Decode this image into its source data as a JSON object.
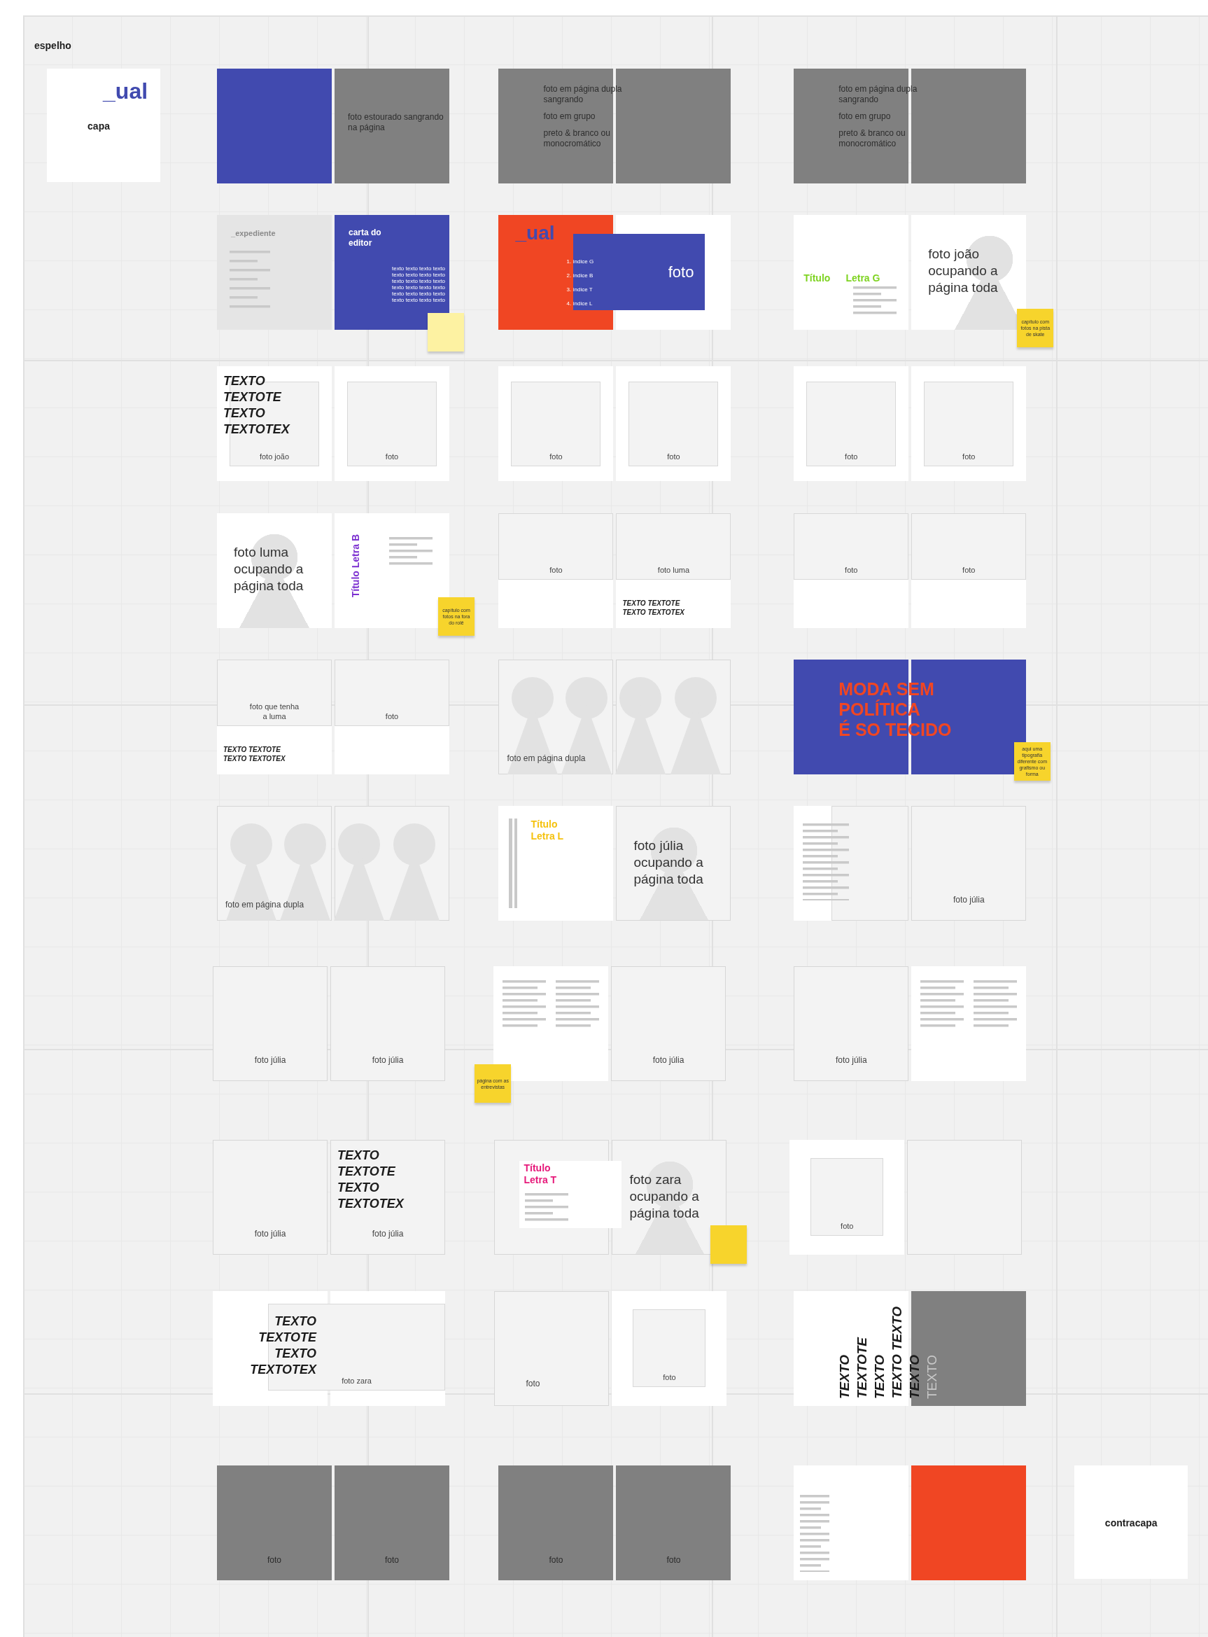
{
  "board_label": "espelho",
  "cards": [
    {
      "logo": "_ual",
      "label": "capa"
    },
    {
      "label": "contracapa"
    }
  ],
  "spreads": [
    {
      "pages": [
        {
          "kind": "blue"
        },
        {
          "kind": "gray",
          "elements": [
            {
              "kind": "note",
              "paragraphs": [
                "foto estourado sangrando na página"
              ]
            }
          ]
        }
      ]
    },
    {
      "pages": [
        {
          "kind": "gray"
        },
        {
          "kind": "gray"
        }
      ],
      "overlays": [
        {
          "kind": "note",
          "paragraphs": [
            "foto em página dupla sangrando",
            "foto em grupo",
            "preto & branco ou monocromático"
          ]
        }
      ]
    },
    {
      "pages": [
        {
          "kind": "gray"
        },
        {
          "kind": "gray"
        }
      ],
      "overlays": [
        {
          "kind": "note",
          "paragraphs": [
            "foto em página dupla sangrando",
            "foto em grupo",
            "preto & branco ou monocromático"
          ]
        }
      ]
    },
    {
      "pages": [
        {
          "kind": "lightgray",
          "elements": [
            {
              "kind": "label",
              "text": "_expediente"
            },
            {
              "kind": "short_lines"
            }
          ]
        },
        {
          "kind": "blue",
          "elements": [
            {
              "kind": "heading",
              "lines": [
                "carta do",
                "editor"
              ]
            },
            {
              "kind": "filler",
              "lines": [
                "texto texto texto texto",
                "texto texto texto texto",
                "texto texto texto texto",
                "texto texto texto texto",
                "texto texto texto texto",
                "texto texto texto texto"
              ]
            }
          ]
        }
      ]
    },
    {
      "pages": [
        {
          "kind": "orange",
          "elements": [
            {
              "kind": "logo",
              "text": "_ual"
            }
          ]
        },
        {
          "kind": "white"
        }
      ],
      "overlays": [
        {
          "kind": "index_list",
          "items": [
            "1. índice G",
            "2. índice B",
            "3. índice T",
            "4. índice L"
          ]
        },
        {
          "kind": "photo_block",
          "caption": "foto"
        }
      ]
    },
    {
      "pages": [
        {
          "kind": "white",
          "elements": [
            {
              "kind": "split_title",
              "color": "#7ed321",
              "lines": [
                "Título",
                "Letra G"
              ]
            },
            {
              "kind": "caption_lines"
            }
          ]
        },
        {
          "kind": "white",
          "elements": [
            {
              "kind": "side_figure"
            },
            {
              "kind": "large",
              "text": "foto joão ocupando a página toda"
            }
          ]
        }
      ]
    },
    {
      "pages": [
        {
          "kind": "white",
          "elements": [
            {
              "kind": "display",
              "lines": [
                "TEXTO",
                "TEXTOTE",
                "TEXTO",
                "TEXTOTEX"
              ]
            },
            {
              "kind": "inset_photo",
              "caption": "foto joão"
            }
          ]
        },
        {
          "kind": "white",
          "elements": [
            {
              "kind": "inset_photo",
              "caption": "foto"
            }
          ]
        }
      ]
    },
    {
      "pages": [
        {
          "kind": "white",
          "elements": [
            {
              "kind": "inset_photo",
              "caption": "foto"
            }
          ]
        },
        {
          "kind": "white",
          "elements": [
            {
              "kind": "inset_photo",
              "caption": "foto"
            }
          ]
        }
      ]
    },
    {
      "pages": [
        {
          "kind": "white",
          "elements": [
            {
              "kind": "inset_photo",
              "caption": "foto"
            }
          ]
        },
        {
          "kind": "white",
          "elements": [
            {
              "kind": "inset_photo",
              "caption": "foto"
            }
          ]
        }
      ]
    },
    {
      "pages": [
        {
          "kind": "white",
          "elements": [
            {
              "kind": "figure"
            },
            {
              "kind": "large",
              "text": "foto luma ocupando a página toda"
            }
          ]
        },
        {
          "kind": "white",
          "elements": [
            {
              "kind": "vertical_title",
              "color": "#7b2fd0",
              "lines": [
                "Título Letra B"
              ]
            },
            {
              "kind": "block_lines"
            }
          ]
        }
      ]
    },
    {
      "pages": [
        {
          "kind": "white",
          "elements": [
            {
              "kind": "top_photo",
              "caption": "foto"
            }
          ]
        },
        {
          "kind": "white",
          "elements": [
            {
              "kind": "top_photo",
              "caption": "foto luma"
            },
            {
              "kind": "display_small",
              "lines": [
                "TEXTO TEXTOTE",
                "TEXTO TEXTOTEX"
              ]
            }
          ]
        }
      ]
    },
    {
      "pages": [
        {
          "kind": "white",
          "elements": [
            {
              "kind": "top_photo",
              "caption": "foto"
            }
          ]
        },
        {
          "kind": "white",
          "elements": [
            {
              "kind": "top_photo",
              "caption": "foto"
            }
          ]
        }
      ]
    },
    {
      "pages": [
        {
          "kind": "white",
          "elements": [
            {
              "kind": "top_photo",
              "caption": "foto que tenha a luma"
            },
            {
              "kind": "display_small",
              "lines": [
                "TEXTO TEXTOTE",
                "TEXTO TEXTOTEX"
              ]
            }
          ]
        },
        {
          "kind": "white",
          "elements": [
            {
              "kind": "top_photo",
              "caption": "foto"
            }
          ]
        }
      ]
    },
    {
      "pages": [
        {
          "kind": "light"
        },
        {
          "kind": "light"
        }
      ],
      "overlays": [
        {
          "kind": "crowd"
        },
        {
          "kind": "caption",
          "text": "foto em página dupla"
        }
      ]
    },
    {
      "pages": [
        {
          "kind": "blue"
        },
        {
          "kind": "blue"
        }
      ],
      "overlays": [
        {
          "kind": "headline",
          "lines": [
            "MODA SEM",
            "POLÍTICA",
            "É SO TECIDO"
          ]
        }
      ]
    },
    {
      "pages": [
        {
          "kind": "light"
        },
        {
          "kind": "light"
        }
      ],
      "overlays": [
        {
          "kind": "crowd"
        },
        {
          "kind": "caption",
          "text": "foto em página dupla"
        }
      ]
    },
    {
      "pages": [
        {
          "kind": "white",
          "elements": [
            {
              "kind": "bars"
            },
            {
              "kind": "title",
              "color": "#f5c20f",
              "lines": [
                "Título",
                "Letra L"
              ]
            }
          ]
        },
        {
          "kind": "light",
          "elements": [
            {
              "kind": "figure"
            },
            {
              "kind": "large",
              "text": "foto júlia ocupando a página toda"
            }
          ]
        }
      ]
    },
    {
      "pages": [
        {
          "kind": "white",
          "elements": [
            {
              "kind": "box"
            },
            {
              "kind": "long_lines"
            }
          ]
        },
        {
          "kind": "light",
          "elements": [
            {
              "kind": "caption",
              "text": "foto júlia"
            }
          ]
        }
      ]
    },
    {
      "pages": [
        {
          "kind": "light",
          "elements": [
            {
              "kind": "caption",
              "text": "foto júlia"
            }
          ]
        },
        {
          "kind": "light",
          "elements": [
            {
              "kind": "caption",
              "text": "foto júlia"
            }
          ]
        }
      ]
    },
    {
      "pages": [
        {
          "kind": "white",
          "elements": [
            {
              "kind": "double_lines"
            }
          ]
        },
        {
          "kind": "light",
          "elements": [
            {
              "kind": "caption",
              "text": "foto júlia"
            }
          ]
        }
      ]
    },
    {
      "pages": [
        {
          "kind": "light",
          "elements": [
            {
              "kind": "caption",
              "text": "foto júlia"
            }
          ]
        },
        {
          "kind": "white",
          "elements": [
            {
              "kind": "double_lines"
            }
          ]
        }
      ]
    },
    {
      "pages": [
        {
          "kind": "light",
          "elements": [
            {
              "kind": "caption",
              "text": "foto júlia"
            }
          ]
        },
        {
          "kind": "light",
          "elements": [
            {
              "kind": "display",
              "lines": [
                "TEXTO",
                "TEXTOTE",
                "TEXTO",
                "TEXTOTEX"
              ]
            },
            {
              "kind": "caption",
              "text": "foto júlia"
            }
          ]
        }
      ]
    },
    {
      "pages": [
        {
          "kind": "light"
        },
        {
          "kind": "light",
          "elements": [
            {
              "kind": "figure"
            },
            {
              "kind": "large",
              "text": "foto zara ocupando a página toda"
            }
          ]
        }
      ],
      "overlays": [
        {
          "kind": "panel",
          "color": "#e6197a",
          "lines": [
            "Título",
            "Letra T"
          ]
        }
      ]
    },
    {
      "pages": [
        {
          "kind": "white",
          "elements": [
            {
              "kind": "small_photo",
              "caption": "foto"
            }
          ]
        },
        {
          "kind": "light"
        }
      ]
    },
    {
      "pages": [
        {
          "kind": "white"
        },
        {
          "kind": "white"
        }
      ],
      "overlays": [
        {
          "kind": "display",
          "lines": [
            "TEXTO",
            "TEXTOTE",
            "TEXTO",
            "TEXTOTEX"
          ]
        },
        {
          "kind": "box",
          "caption": "foto zara"
        }
      ]
    },
    {
      "pages": [
        {
          "kind": "light",
          "elements": [
            {
              "kind": "corner_caption",
              "text": "foto"
            }
          ]
        },
        {
          "kind": "white",
          "elements": [
            {
              "kind": "small_photo",
              "caption": "foto"
            }
          ]
        }
      ]
    },
    {
      "pages": [
        {
          "kind": "white"
        },
        {
          "kind": "gray"
        }
      ],
      "overlays": [
        {
          "kind": "vertical_text",
          "columns": [
            {
              "text": "TEXTO",
              "muted": false
            },
            {
              "text": "TEXTOTE",
              "muted": false
            },
            {
              "text": "TEXTO",
              "muted": false
            },
            {
              "text": "TEXTO TEXTO",
              "muted": false
            },
            {
              "text": "TEXTO",
              "muted": false
            },
            {
              "text": "TEXTO",
              "muted": true
            }
          ]
        }
      ]
    },
    {
      "pages": [
        {
          "kind": "gray",
          "elements": [
            {
              "kind": "caption",
              "text": "foto"
            }
          ]
        },
        {
          "kind": "gray",
          "elements": [
            {
              "kind": "caption",
              "text": "foto"
            }
          ]
        }
      ]
    },
    {
      "pages": [
        {
          "kind": "gray",
          "elements": [
            {
              "kind": "caption",
              "text": "foto"
            }
          ]
        },
        {
          "kind": "gray",
          "elements": [
            {
              "kind": "caption",
              "text": "foto"
            }
          ]
        }
      ]
    },
    {
      "pages": [
        {
          "kind": "white",
          "elements": [
            {
              "kind": "narrow_lines"
            }
          ]
        },
        {
          "kind": "orange"
        }
      ]
    }
  ],
  "sticky_notes": [
    {
      "color": "#fdf2a2"
    },
    {
      "color": "#f7d42c",
      "text": "capítulo com fotos na pista de skate"
    },
    {
      "color": "#f7d42c",
      "text": "capítulo com fotos na fora do rolê"
    },
    {
      "color": "#f7d42c",
      "text": "aqui uma tipografia diferente com grafismo ou forma"
    },
    {
      "color": "#f7d42c",
      "text": "página com as entrevistas"
    },
    {
      "color": "#f7d42c"
    }
  ]
}
